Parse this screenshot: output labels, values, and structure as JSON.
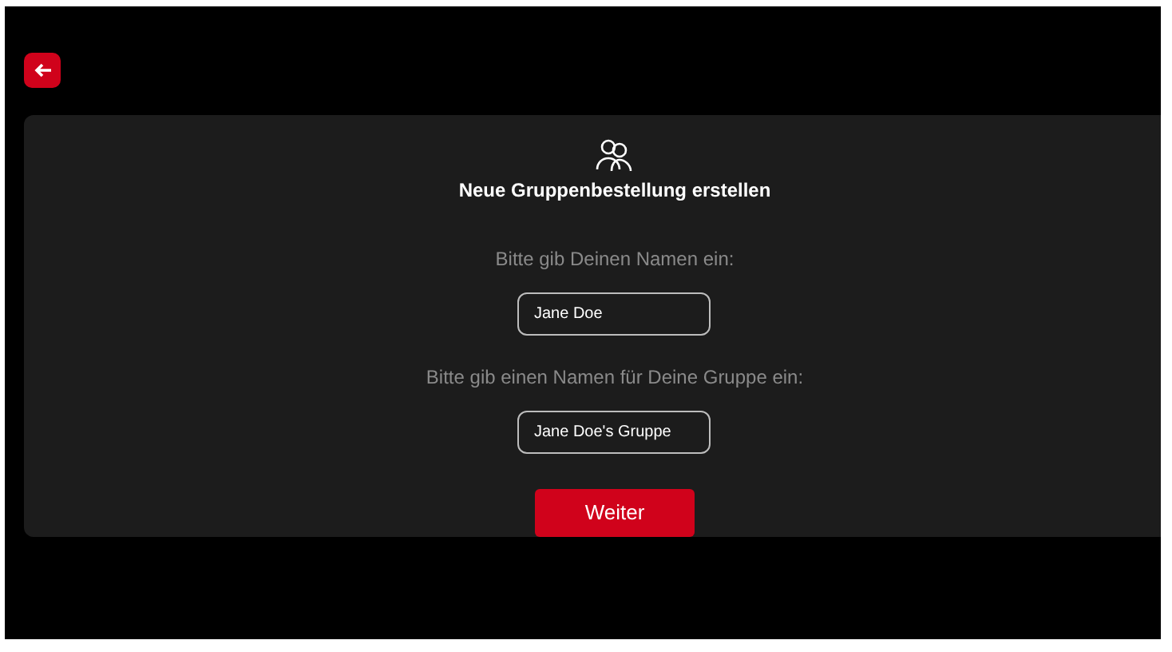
{
  "back_button": {
    "kind": "back"
  },
  "title": "Neue Gruppenbestellung erstellen",
  "fields": [
    {
      "label": "Bitte gib Deinen Namen ein:",
      "value": "Jane Doe"
    },
    {
      "label": "Bitte gib einen Namen für Deine Gruppe ein:",
      "value": "Jane Doe's Gruppe"
    }
  ],
  "submit_button": "Weiter"
}
